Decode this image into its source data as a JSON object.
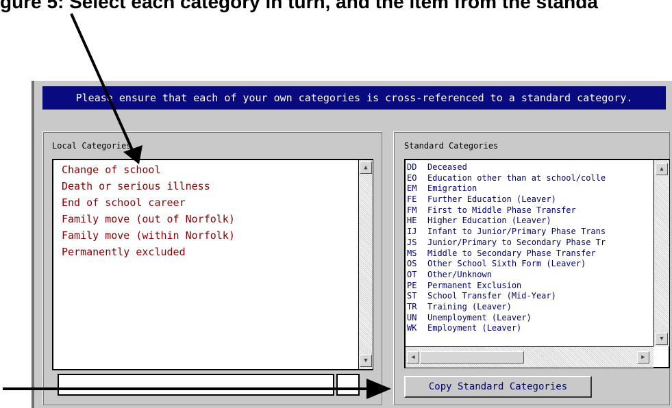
{
  "caption": "gure 5: Select each category in turn, and the item from the standa",
  "banner": "Please ensure that each of your own categories is cross-referenced to a standard category.",
  "local": {
    "label": "Local Categories",
    "items": [
      "Change of school",
      "Death or serious illness",
      "End of school career",
      "Family move (out of Norfolk)",
      "Family move (within Norfolk)",
      "Permanently excluded"
    ]
  },
  "standard": {
    "label": "Standard Categories",
    "items": [
      {
        "code": "DD",
        "label": "Deceased"
      },
      {
        "code": "EO",
        "label": "Education other than at school/colle"
      },
      {
        "code": "EM",
        "label": "Emigration"
      },
      {
        "code": "FE",
        "label": "Further Education (Leaver)"
      },
      {
        "code": "FM",
        "label": "First to Middle Phase Transfer"
      },
      {
        "code": "HE",
        "label": "Higher Education (Leaver)"
      },
      {
        "code": "IJ",
        "label": "Infant to Junior/Primary Phase Trans"
      },
      {
        "code": "JS",
        "label": "Junior/Primary to Secondary Phase Tr"
      },
      {
        "code": "MS",
        "label": "Middle to Secondary Phase Transfer"
      },
      {
        "code": "OS",
        "label": "Other School Sixth Form (Leaver)"
      },
      {
        "code": "OT",
        "label": "Other/Unknown"
      },
      {
        "code": "PE",
        "label": "Permanent Exclusion"
      },
      {
        "code": "ST",
        "label": "School Transfer (Mid-Year)"
      },
      {
        "code": "TR",
        "label": "Training (Leaver)"
      },
      {
        "code": "UN",
        "label": "Unemployment (Leaver)"
      },
      {
        "code": "WK",
        "label": "Employment (Leaver)"
      }
    ]
  },
  "copy_button": "Copy Standard Categories",
  "colors": {
    "banner": "#0a0a80",
    "local_text": "#8b0000",
    "standard_text": "#00007a"
  }
}
